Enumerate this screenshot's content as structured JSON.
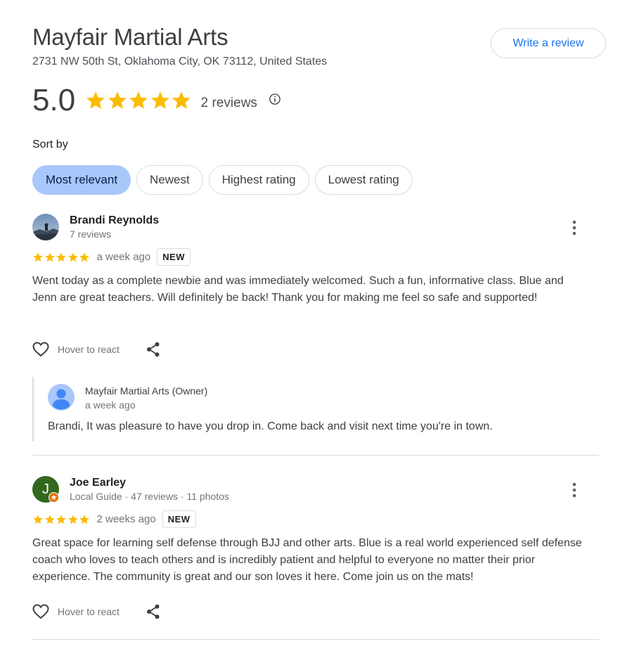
{
  "business": {
    "name": "Mayfair Martial Arts",
    "address": "2731 NW 50th St, Oklahoma City, OK 73112, United States",
    "write_review_label": "Write a review",
    "rating": "5.0",
    "stars": 5,
    "review_count": "2 reviews"
  },
  "sort": {
    "label": "Sort by",
    "options": [
      "Most relevant",
      "Newest",
      "Highest rating",
      "Lowest rating"
    ],
    "selected": "Most relevant"
  },
  "colors": {
    "star": "#fbbc04",
    "accent_blue": "#1a73e8",
    "chip_active": "#a8c7fa",
    "joe_avatar": "#33691e",
    "local_guide_badge": "#e8710a"
  },
  "reviews": [
    {
      "name": "Brandi Reynolds",
      "meta": "7 reviews",
      "stars": 5,
      "date": "a week ago",
      "badge": "NEW",
      "text": "Went today as a complete newbie and was immediately welcomed. Such a fun, informative class. Blue and Jenn are great teachers. Will definitely be back! Thank you for making me feel so safe and supported!",
      "react_label": "Hover to react",
      "owner_reply": {
        "name": "Mayfair Martial Arts (Owner)",
        "date": "a week ago",
        "text": "Brandi, It was pleasure to have you drop in. Come back and visit next time you're in town."
      }
    },
    {
      "name": "Joe Earley",
      "avatar_letter": "J",
      "meta": "Local Guide · 47 reviews · 11 photos",
      "stars": 5,
      "date": "2 weeks ago",
      "badge": "NEW",
      "text": "Great space for learning self defense through BJJ and other arts. Blue is a real world experienced self defense coach who loves to teach others and is incredibly patient and helpful to everyone no matter their prior experience. The community is great and our son loves it here. Come join us on the mats!",
      "react_label": "Hover to react"
    }
  ]
}
